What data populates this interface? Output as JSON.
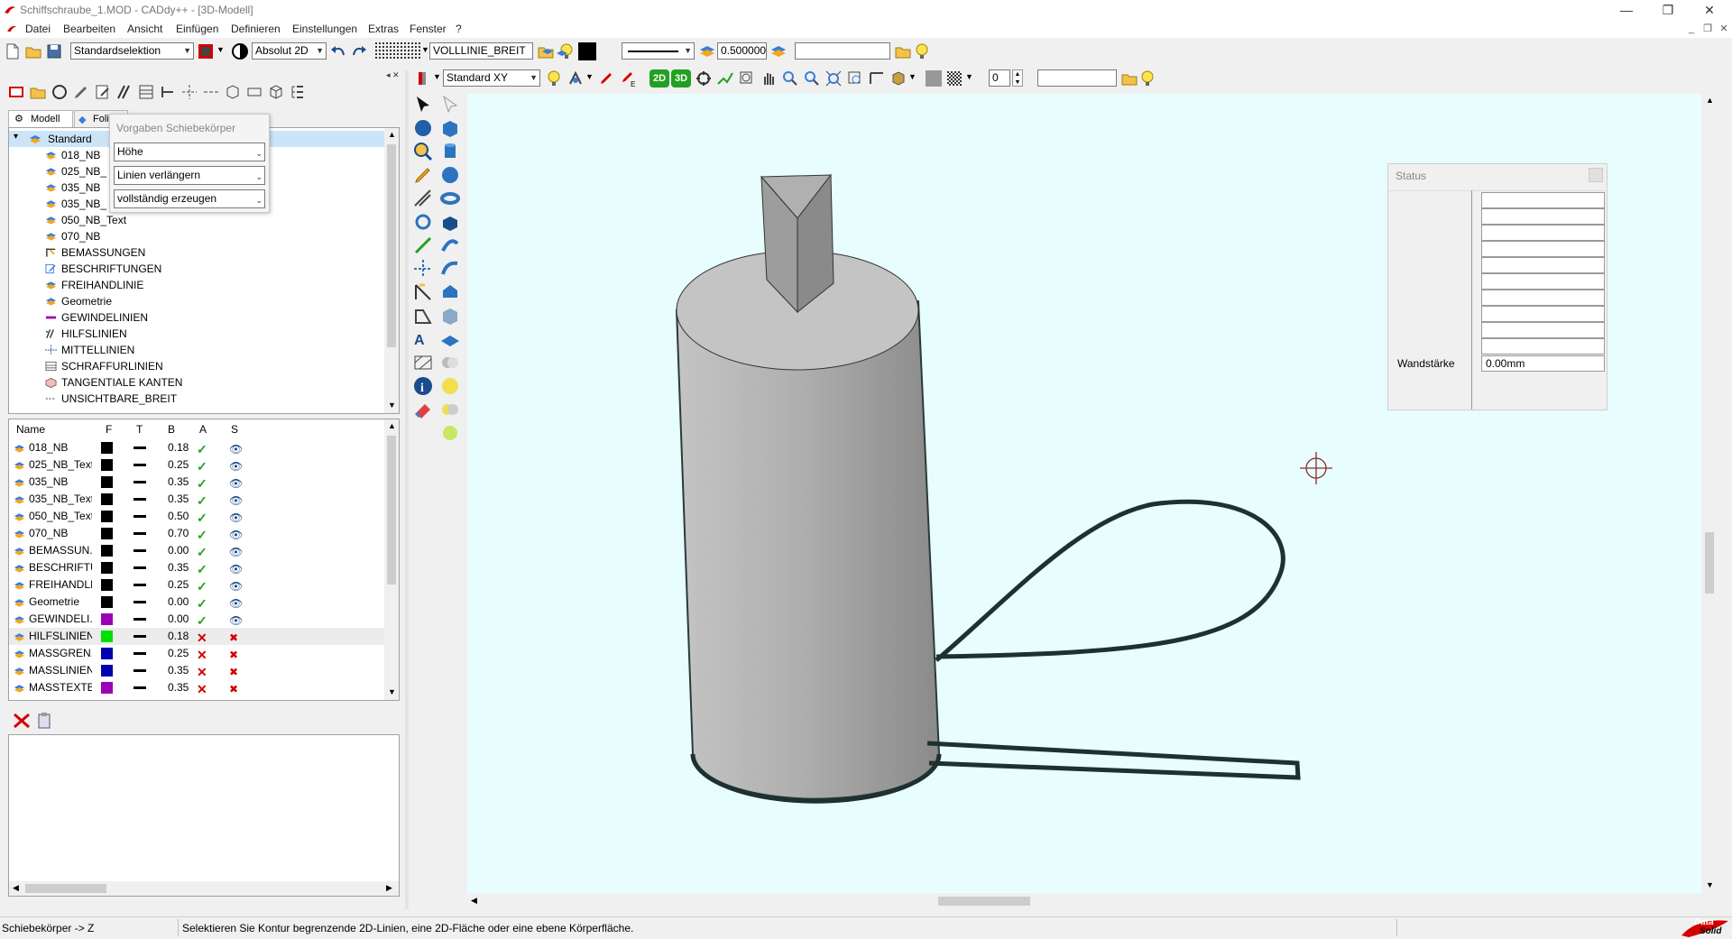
{
  "window": {
    "title": "Schiffschraube_1.MOD  -  CADdy++ - [3D-Modell]",
    "buttons": {
      "minimize": "—",
      "maximize": "❐",
      "close": "✕"
    }
  },
  "menu": {
    "items": [
      "Datei",
      "Bearbeiten",
      "Ansicht",
      "Einfügen",
      "Definieren",
      "Einstellungen",
      "Extras",
      "Fenster",
      "?"
    ]
  },
  "toolbar_top": {
    "selection_mode": "Standardselektion",
    "coord_mode": "Absolut 2D",
    "linetype": "VOLLLINIE_BREIT",
    "line_width": "0.500000",
    "extra_field": ""
  },
  "toolbar_view": {
    "view_plane": "Standard XY",
    "layer_number": "0",
    "extra_field": "",
    "btn_2d": "2D",
    "btn_3d": "3D"
  },
  "left_panel": {
    "tabs": [
      "Modell",
      "Folien"
    ],
    "tree_root": "Standard",
    "tree_items": [
      "018_NB",
      "025_NB_",
      "035_NB",
      "035_NB_",
      "050_NB_Text",
      "070_NB",
      "BEMASSUNGEN",
      "BESCHRIFTUNGEN",
      "FREIHANDLINIE",
      "Geometrie",
      "GEWINDELINIEN",
      "HILFSLINIEN",
      "MITTELLINIEN",
      "SCHRAFFURLINIEN",
      "TANGENTIALE KANTEN",
      "UNSICHTBARE_BREIT"
    ],
    "layer_columns": [
      "Name",
      "F",
      "T",
      "B",
      "A",
      "S"
    ],
    "layers": [
      {
        "name": "018_NB",
        "color": "#000000",
        "width": "0.18",
        "active": true,
        "visible": true
      },
      {
        "name": "025_NB_Text",
        "color": "#000000",
        "width": "0.25",
        "active": true,
        "visible": true
      },
      {
        "name": "035_NB",
        "color": "#000000",
        "width": "0.35",
        "active": true,
        "visible": true
      },
      {
        "name": "035_NB_Text",
        "color": "#000000",
        "width": "0.35",
        "active": true,
        "visible": true
      },
      {
        "name": "050_NB_Text",
        "color": "#000000",
        "width": "0.50",
        "active": true,
        "visible": true
      },
      {
        "name": "070_NB",
        "color": "#000000",
        "width": "0.70",
        "active": true,
        "visible": true
      },
      {
        "name": "BEMASSUN...",
        "color": "#000000",
        "width": "0.00",
        "active": true,
        "visible": true
      },
      {
        "name": "BESCHRIFTU...",
        "color": "#000000",
        "width": "0.35",
        "active": true,
        "visible": true
      },
      {
        "name": "FREIHANDLI...",
        "color": "#000000",
        "width": "0.25",
        "active": true,
        "visible": true
      },
      {
        "name": "Geometrie",
        "color": "#000000",
        "width": "0.00",
        "active": true,
        "visible": true
      },
      {
        "name": "GEWINDELI...",
        "color": "#9c00b4",
        "width": "0.00",
        "active": true,
        "visible": true
      },
      {
        "name": "HILFSLINIEN",
        "color": "#00e000",
        "width": "0.18",
        "active": false,
        "visible": false
      },
      {
        "name": "MASSGREN...",
        "color": "#0000b0",
        "width": "0.25",
        "active": false,
        "visible": false
      },
      {
        "name": "MASSLINIEN",
        "color": "#0000b0",
        "width": "0.35",
        "active": false,
        "visible": false
      },
      {
        "name": "MASSTEXTE",
        "color": "#9c00b4",
        "width": "0.35",
        "active": false,
        "visible": false
      }
    ]
  },
  "popup": {
    "title": "Vorgaben Schiebekörper",
    "options": [
      "Höhe",
      "Linien verlängern",
      "vollständig erzeugen"
    ]
  },
  "status_window": {
    "title": "Status",
    "label": "Wandstärke",
    "value": "0.00mm"
  },
  "statusbar": {
    "left": "Schiebekörper -> Z",
    "message": "Selektieren Sie Kontur begrenzende 2D-Linien, eine 2D-Fläche oder eine ebene Körperfläche.",
    "brand_line1": "Data",
    "brand_line2": "Solid"
  },
  "colors": {
    "viewport_bg": "#e8fefe",
    "accent_red": "#d40000"
  }
}
